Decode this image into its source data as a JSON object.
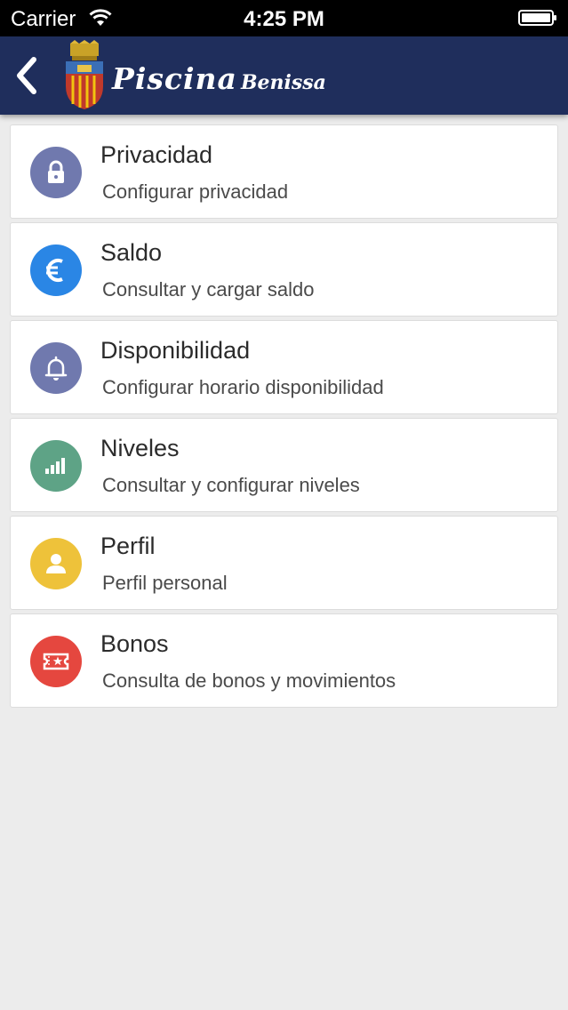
{
  "status_bar": {
    "carrier": "Carrier",
    "time": "4:25 PM"
  },
  "header": {
    "title": "Piscina",
    "subtitle": "Benissa",
    "background": "#1f2e5c"
  },
  "menu": [
    {
      "title": "Privacidad",
      "subtitle": "Configurar privacidad",
      "icon": "lock-icon",
      "color": "#7079ae"
    },
    {
      "title": "Saldo",
      "subtitle": "Consultar y cargar saldo",
      "icon": "euro-icon",
      "color": "#2a86e5"
    },
    {
      "title": "Disponibilidad",
      "subtitle": "Configurar horario disponibilidad",
      "icon": "bell-icon",
      "color": "#7079ae"
    },
    {
      "title": "Niveles",
      "subtitle": "Consultar y configurar niveles",
      "icon": "bars-icon",
      "color": "#5ea386"
    },
    {
      "title": "Perfil",
      "subtitle": "Perfil personal",
      "icon": "person-icon",
      "color": "#eec23a"
    },
    {
      "title": "Bonos",
      "subtitle": "Consulta de bonos y movimientos",
      "icon": "ticket-icon",
      "color": "#e5473f"
    }
  ]
}
